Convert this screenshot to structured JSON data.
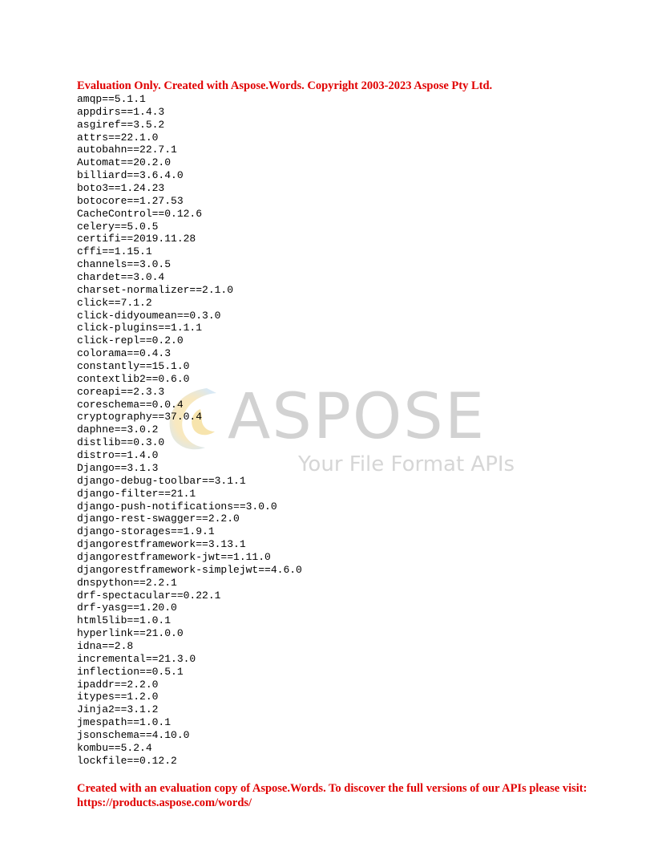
{
  "document": {
    "header_note": "Evaluation  Only. Created with  Aspose.Words. Copyright  2003-2023 Aspose Pty Ltd.",
    "requirements": [
      "amqp==5.1.1",
      "appdirs==1.4.3",
      "asgiref==3.5.2",
      "attrs==22.1.0",
      "autobahn==22.7.1",
      "Automat==20.2.0",
      "billiard==3.6.4.0",
      "boto3==1.24.23",
      "botocore==1.27.53",
      "CacheControl==0.12.6",
      "celery==5.0.5",
      "certifi==2019.11.28",
      "cffi==1.15.1",
      "channels==3.0.5",
      "chardet==3.0.4",
      "charset-normalizer==2.1.0",
      "click==7.1.2",
      "click-didyoumean==0.3.0",
      "click-plugins==1.1.1",
      "click-repl==0.2.0",
      "colorama==0.4.3",
      "constantly==15.1.0",
      "contextlib2==0.6.0",
      "coreapi==2.3.3",
      "coreschema==0.0.4",
      "cryptography==37.0.4",
      "daphne==3.0.2",
      "distlib==0.3.0",
      "distro==1.4.0",
      "Django==3.1.3",
      "django-debug-toolbar==3.1.1",
      "django-filter==21.1",
      "django-push-notifications==3.0.0",
      "django-rest-swagger==2.2.0",
      "django-storages==1.9.1",
      "djangorestframework==3.13.1",
      "djangorestframework-jwt==1.11.0",
      "djangorestframework-simplejwt==4.6.0",
      "dnspython==2.2.1",
      "drf-spectacular==0.22.1",
      "drf-yasg==1.20.0",
      "html5lib==1.0.1",
      "hyperlink==21.0.0",
      "idna==2.8",
      "incremental==21.3.0",
      "inflection==0.5.1",
      "ipaddr==2.2.0",
      "itypes==1.2.0",
      "Jinja2==3.1.2",
      "jmespath==1.0.1",
      "jsonschema==4.10.0",
      "kombu==5.2.4",
      "lockfile==0.12.2"
    ],
    "footer_note": "Created with  an evaluation copy of Aspose.Words. To discover the full versions of our APIs please visit: https://products.aspose.com/words/"
  },
  "watermark": {
    "title": "ASPOSE",
    "subtitle": "Your File Format APIs"
  },
  "colors": {
    "notice_red": "#e00000",
    "watermark_gray": "#d2d2d2"
  }
}
